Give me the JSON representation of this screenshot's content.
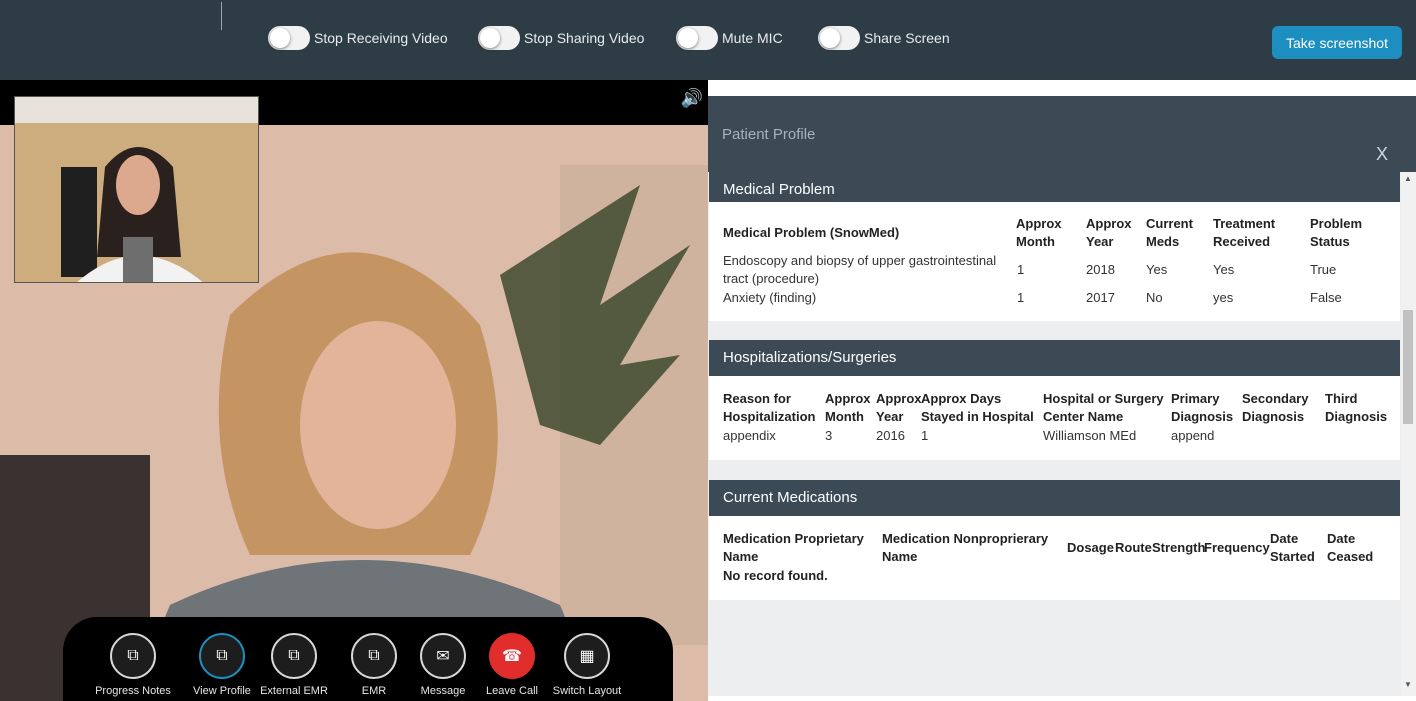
{
  "toolbar": {
    "toggles": [
      {
        "label": "Stop Receiving Video"
      },
      {
        "label": "Stop Sharing Video"
      },
      {
        "label": "Mute MIC"
      },
      {
        "label": "Share Screen"
      }
    ],
    "screenshot_label": "Take screenshot"
  },
  "controls": [
    {
      "label": "Progress Notes"
    },
    {
      "label": "View Profile"
    },
    {
      "label": "External EMR"
    },
    {
      "label": "EMR"
    },
    {
      "label": "Message"
    },
    {
      "label": "Leave Call"
    },
    {
      "label": "Switch Layout"
    }
  ],
  "profile": {
    "title": "Patient Profile",
    "close": "X",
    "medical": {
      "heading": "Medical Problem",
      "headers": [
        "Medical Problem (SnowMed)",
        "Approx Month",
        "Approx Year",
        "Current Meds",
        "Treatment Received",
        "Problem Status"
      ],
      "rows": [
        [
          "Endoscopy and biopsy of upper gastrointestinal tract (procedure)",
          "1",
          "2018",
          "Yes",
          "Yes",
          "True"
        ],
        [
          "Anxiety (finding)",
          "1",
          "2017",
          "No",
          "yes",
          "False"
        ]
      ]
    },
    "hosp": {
      "heading": "Hospitalizations/Surgeries",
      "headers": [
        "Reason for Hospitalization",
        "Approx Month",
        "Approx Year",
        "Approx Days Stayed in Hospital",
        "Hospital or Surgery Center Name",
        "Primary Diagnosis",
        "Secondary Diagnosis",
        "Third Diagnosis"
      ],
      "row": [
        "appendix",
        "3",
        "2016",
        "1",
        "Williamson MEd",
        "append",
        "",
        ""
      ]
    },
    "meds": {
      "heading": "Current Medications",
      "headers": [
        "Medication Proprietary Name",
        "Medication Nonproprierary Name",
        "Dosage",
        "Route",
        "Strength",
        "Frequency",
        "Date Started",
        "Date Ceased"
      ],
      "empty": "No record found."
    }
  },
  "colors": {
    "header_bg": "#2e3c46",
    "section_bg": "#3b4a55",
    "accent": "#1c8fc0",
    "danger": "#e22d2d"
  }
}
